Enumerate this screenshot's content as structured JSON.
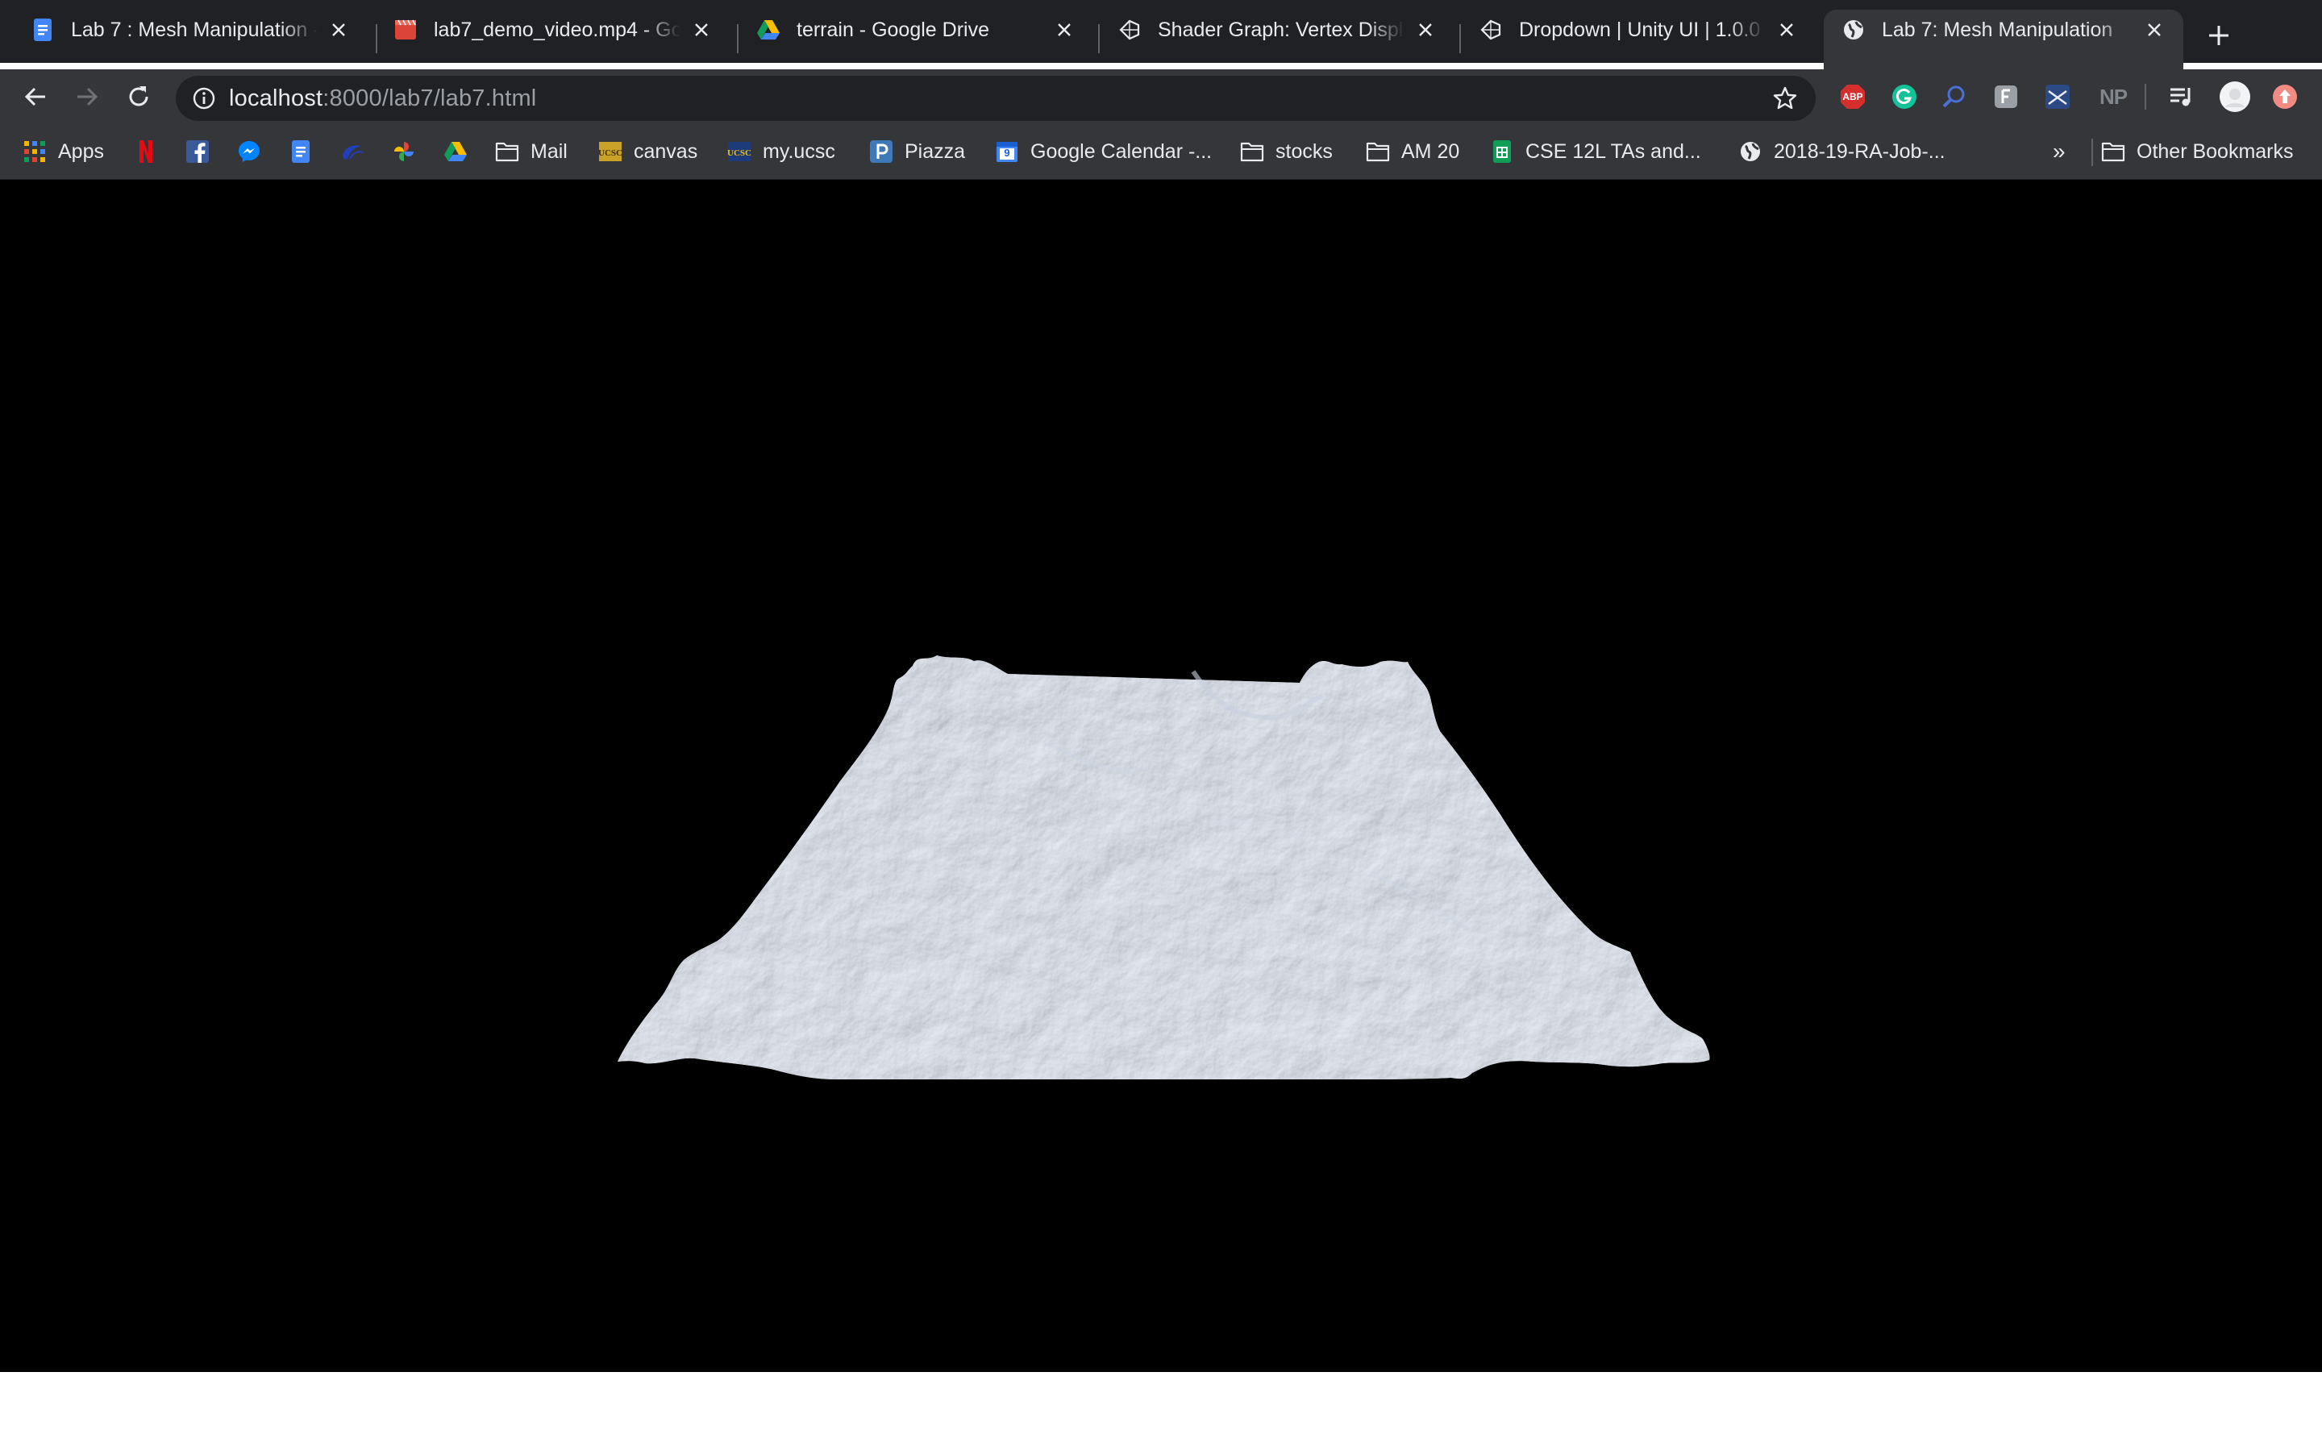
{
  "tabs": [
    {
      "title": "Lab 7 : Mesh Manipulation -",
      "favicon": "google-docs-icon"
    },
    {
      "title": "lab7_demo_video.mp4 - Goo",
      "favicon": "video-file-icon"
    },
    {
      "title": "terrain - Google Drive",
      "favicon": "google-drive-icon"
    },
    {
      "title": "Shader Graph: Vertex Displa",
      "favicon": "unity-icon"
    },
    {
      "title": "Dropdown | Unity UI | 1.0.0",
      "favicon": "unity-icon"
    },
    {
      "title": "Lab 7: Mesh Manipulation",
      "favicon": "globe-icon",
      "active": true
    }
  ],
  "toolbar": {
    "url_host": "localhost",
    "url_path": ":8000/lab7/lab7.html",
    "extensions": [
      "adblock-plus-icon",
      "grammarly-icon",
      "search-ext-icon",
      "extension-icon",
      "ruler-ext-icon",
      "np-ext-icon",
      "media-control-icon",
      "profile-avatar-icon",
      "update-icon"
    ],
    "abp_label": "ABP",
    "np_label": "NP"
  },
  "bookmarks": {
    "apps": "Apps",
    "mail": "Mail",
    "canvas": "canvas",
    "myucsc": "my.ucsc",
    "piazza": "Piazza",
    "gcal": "Google Calendar -...",
    "stocks": "stocks",
    "am20": "AM 20",
    "cse12l": "CSE 12L TAs and...",
    "ra_job": "2018-19-RA-Job-...",
    "overflow": "»",
    "other": "Other Bookmarks",
    "calendar_day": "9"
  },
  "colors": {
    "tabstrip": "#202124",
    "toolbar": "#35363a",
    "viewport": "#000000",
    "terrain": "#e4ebf7"
  }
}
